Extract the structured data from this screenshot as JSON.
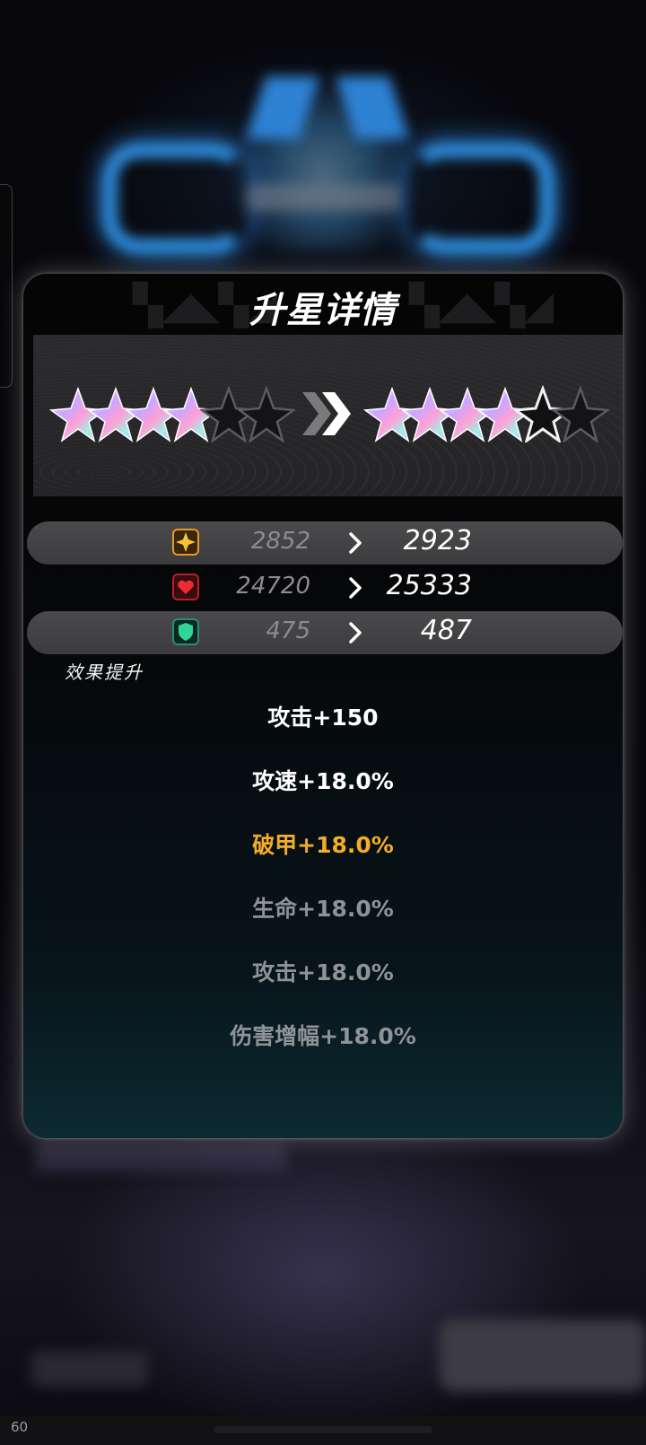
{
  "panel": {
    "title": "升星详情"
  },
  "stars": {
    "before_filled": 4,
    "after_filled": 4,
    "after_next_outline": 1,
    "total": 6
  },
  "stats": [
    {
      "icon": "star-attack-icon",
      "old": "2852",
      "new": "2923"
    },
    {
      "icon": "heart-hp-icon",
      "old": "24720",
      "new": "25333"
    },
    {
      "icon": "shield-defense-icon",
      "old": "475",
      "new": "487"
    }
  ],
  "effects": {
    "heading": "效果提升",
    "items": [
      {
        "text": "攻击+150",
        "state": "active"
      },
      {
        "text": "攻速+18.0%",
        "state": "active"
      },
      {
        "text": "破甲+18.0%",
        "state": "highlight"
      },
      {
        "text": "生命+18.0%",
        "state": "inactive"
      },
      {
        "text": "攻击+18.0%",
        "state": "inactive"
      },
      {
        "text": "伤害增幅+18.0%",
        "state": "inactive"
      }
    ]
  },
  "status_bar": {
    "fps": "60"
  },
  "colors": {
    "highlight": "#f4ac2a",
    "inactive": "#8f9396",
    "active": "#ffffff"
  }
}
